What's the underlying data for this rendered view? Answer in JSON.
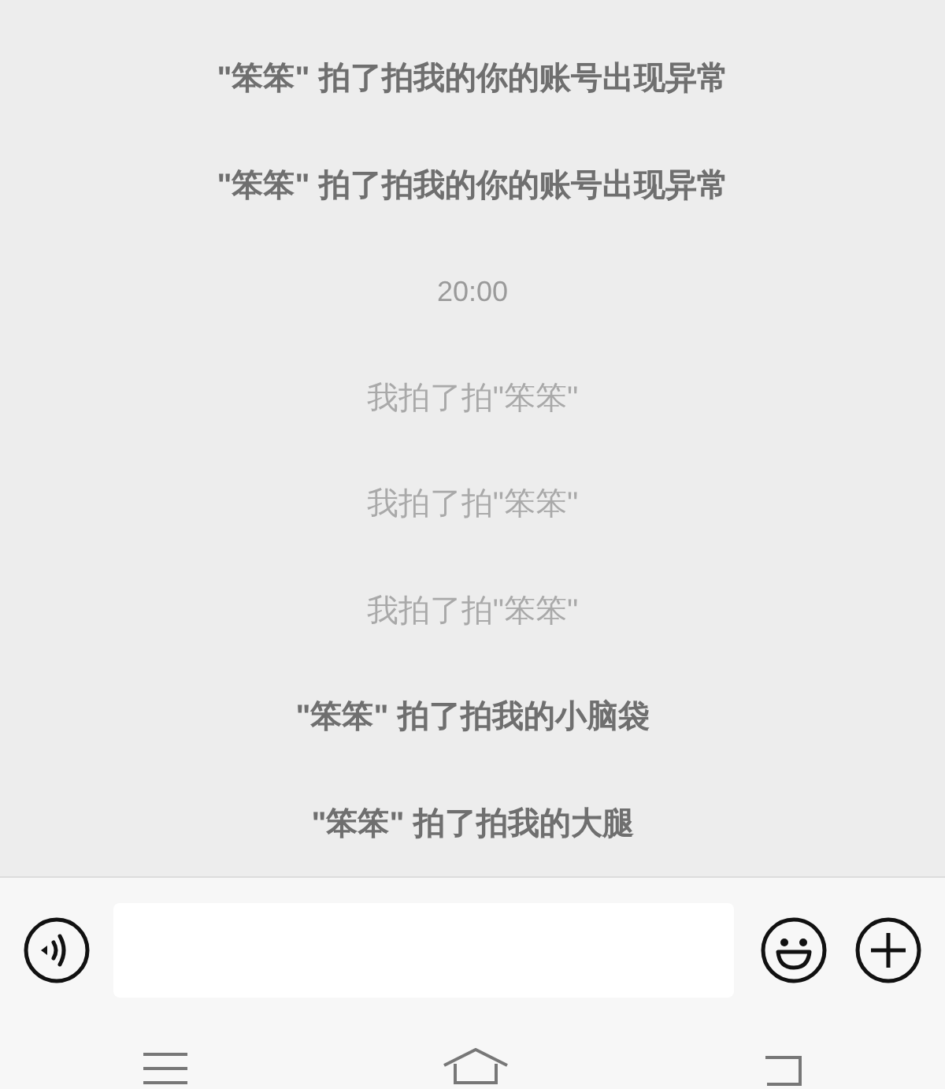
{
  "messages": [
    {
      "kind": "pat_in",
      "text": "\"笨笨\" 拍了拍我的你的账号出现异常"
    },
    {
      "kind": "pat_in",
      "text": "\"笨笨\" 拍了拍我的你的账号出现异常"
    },
    {
      "kind": "time",
      "text": "20:00"
    },
    {
      "kind": "pat_out",
      "text": "我拍了拍\"笨笨\""
    },
    {
      "kind": "pat_out",
      "text": "我拍了拍\"笨笨\""
    },
    {
      "kind": "pat_out",
      "text": "我拍了拍\"笨笨\""
    },
    {
      "kind": "pat_in",
      "text": "\"笨笨\" 拍了拍我的小脑袋"
    },
    {
      "kind": "pat_in",
      "text": "\"笨笨\" 拍了拍我的大腿"
    }
  ]
}
